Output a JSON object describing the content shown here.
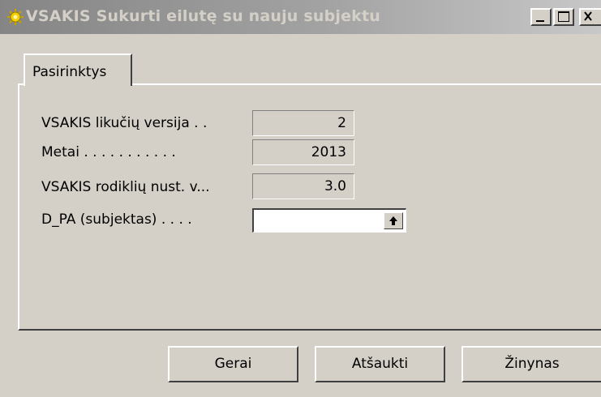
{
  "window": {
    "title": "VSAKIS Sukurti eilutę su nauju subjektu",
    "icon": "sun-gear-icon",
    "controls": [
      "minimize-icon",
      "maximize-icon",
      "close-icon"
    ]
  },
  "tab": {
    "label": "Pasirinktys"
  },
  "fields": [
    {
      "label": "VSAKIS likučių versija . .",
      "value": "2"
    },
    {
      "label": "Metai . . . . . . . . . . .",
      "value": "2013"
    },
    {
      "label": "VSAKIS rodiklių nust. v...",
      "value": "3.0"
    }
  ],
  "input": {
    "label": "D_PA (subjektas) . . . .",
    "value": "",
    "lookup_icon": "arrow-up-icon"
  },
  "buttons": {
    "ok": "Gerai",
    "cancel": "Atšaukti",
    "help": "Žinynas"
  },
  "colors": {
    "face": "#d4d0c8",
    "titlebar_inactive": "#a3a3a3",
    "title_text": "#d4d0c8"
  }
}
